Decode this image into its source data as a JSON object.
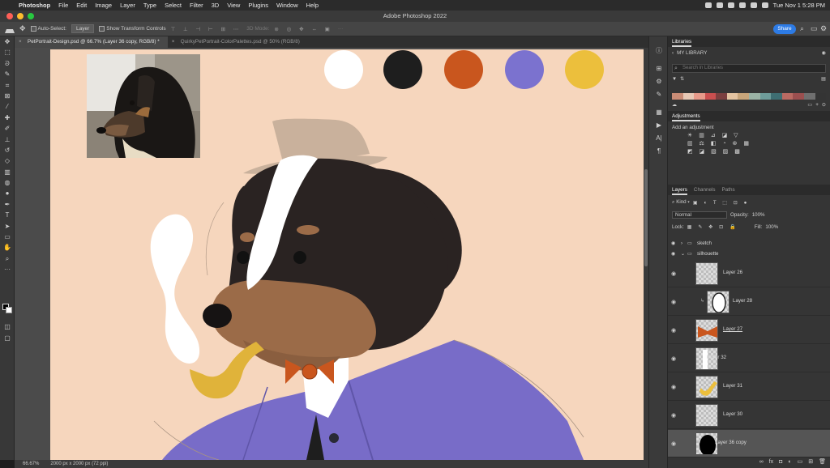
{
  "menubar": {
    "app": "Photoshop",
    "items": [
      "File",
      "Edit",
      "Image",
      "Layer",
      "Type",
      "Select",
      "Filter",
      "3D",
      "View",
      "Plugins",
      "Window",
      "Help"
    ],
    "datetime": "Tue Nov 1  5:28 PM"
  },
  "window": {
    "title": "Adobe Photoshop 2022"
  },
  "options_bar": {
    "auto_select_label": "Auto-Select:",
    "auto_select_value": "Layer",
    "transform_label": "Show Transform Controls",
    "mode_3d_label": "3D Mode:",
    "share_label": "Share"
  },
  "tabs": [
    {
      "label": "PetPortrait-Design.psd @ 66.7% (Layer 36 copy, RGB/8) *",
      "active": true
    },
    {
      "label": "QuirkyPetPortrait-ColorPalettes.psd @ 50% (RGB/8)",
      "active": false
    }
  ],
  "canvas": {
    "background": "#f6d6bd",
    "palette": [
      "#ffffff",
      "#1e1e1e",
      "#c9561e",
      "#7b72cf",
      "#ecbf3c"
    ]
  },
  "status": {
    "zoom": "66.67%",
    "doc_info": "2000 px x 2000 px (72 ppi)"
  },
  "panels": {
    "libraries": {
      "title": "Libraries",
      "library_name": "MY LIBRARY",
      "search_placeholder": "Search in Libraries",
      "color_swatches": [
        "#c98c76",
        "#e7c8b5",
        "#e79a8a",
        "#c94f4f",
        "#7a3f3f",
        "#e4c4a1",
        "#c7a57a",
        "#9bb3a5",
        "#6e9c9a",
        "#3e6e72",
        "#b96a62",
        "#9b4f4f",
        "#6f6f6f",
        "#343434"
      ]
    },
    "adjustments": {
      "title": "Adjustments",
      "add_label": "Add an adjustment"
    },
    "layers": {
      "tabs": [
        "Layers",
        "Channels",
        "Paths"
      ],
      "kind_label": "Kind",
      "blend_mode": "Normal",
      "opacity_label": "Opacity:",
      "opacity_value": "100%",
      "lock_label": "Lock:",
      "fill_label": "Fill:",
      "fill_value": "100%",
      "groups": [
        "sketch",
        "silhouette"
      ],
      "items": [
        {
          "name": "Layer 26"
        },
        {
          "name": "Layer 28"
        },
        {
          "name": "Layer 27"
        },
        {
          "name": "Layer 32"
        },
        {
          "name": "Layer 31"
        },
        {
          "name": "Layer 30"
        },
        {
          "name": "Layer 36 copy"
        }
      ]
    }
  }
}
